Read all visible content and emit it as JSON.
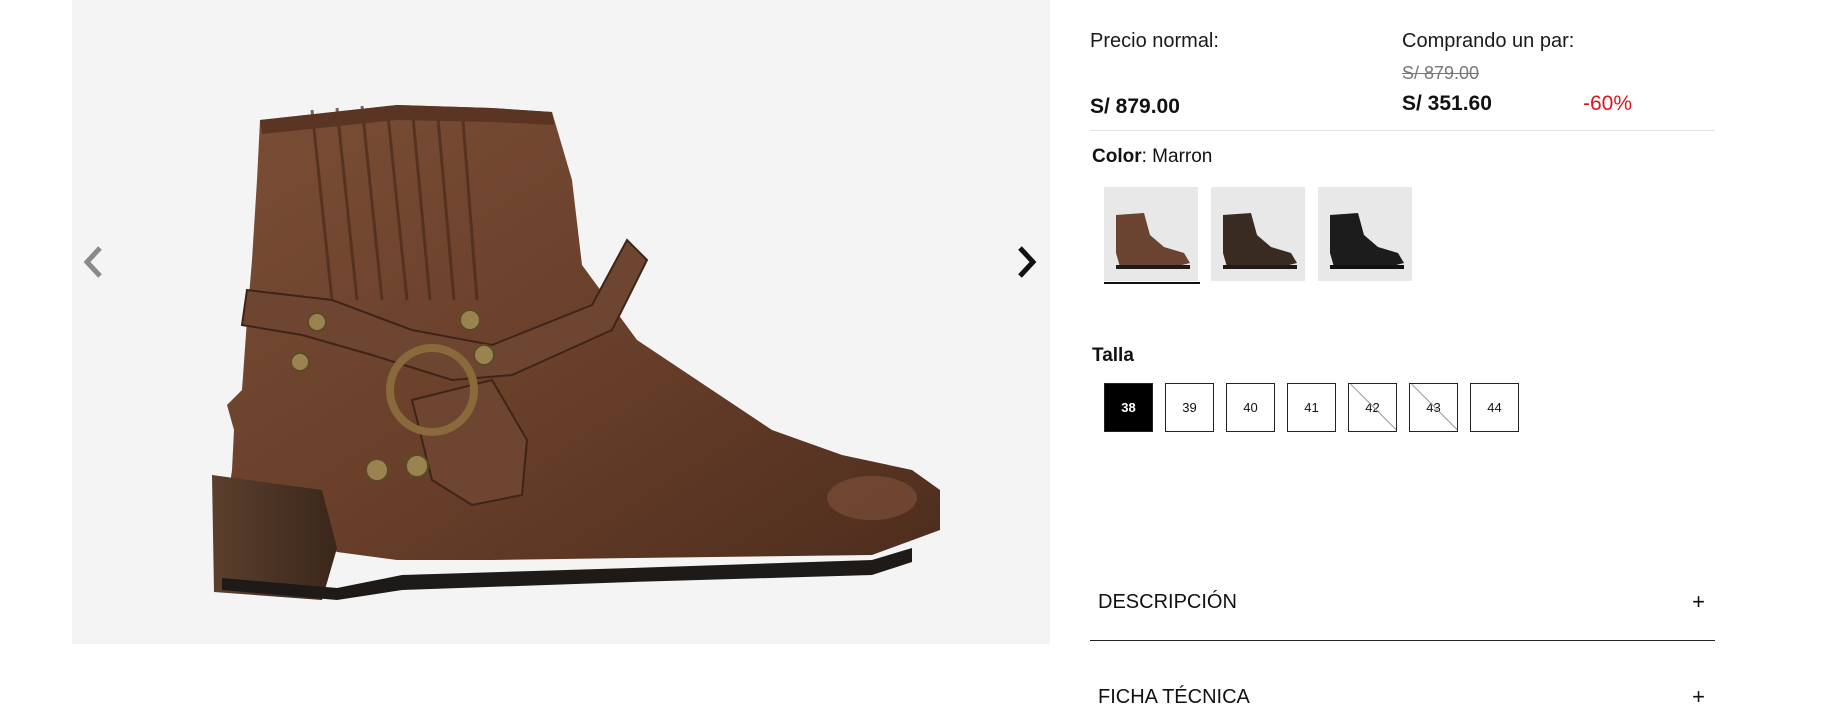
{
  "gallery": {
    "image_alt": "Botin marron con correa y hebilla",
    "prev_icon": "chevron-left-icon",
    "next_icon": "chevron-right-icon"
  },
  "pricing": {
    "normal_label": "Precio normal:",
    "normal_price": "S/ 879.00",
    "pair_label": "Comprando un par:",
    "pair_old_price": "S/ 879.00",
    "pair_price": "S/ 351.60",
    "discount": "-60%",
    "discount_color": "#e0141e"
  },
  "color": {
    "label": "Color",
    "value": "Marron",
    "swatches": [
      {
        "name": "Marron",
        "selected": true,
        "tone": "#6b4431"
      },
      {
        "name": "Cafe oscuro",
        "selected": false,
        "tone": "#3a2b22"
      },
      {
        "name": "Negro",
        "selected": false,
        "tone": "#1c1c1c"
      }
    ]
  },
  "size": {
    "label": "Talla",
    "options": [
      {
        "value": "38",
        "state": "selected"
      },
      {
        "value": "39",
        "state": "available"
      },
      {
        "value": "40",
        "state": "available"
      },
      {
        "value": "41",
        "state": "available"
      },
      {
        "value": "42",
        "state": "unavailable"
      },
      {
        "value": "43",
        "state": "unavailable"
      },
      {
        "value": "44",
        "state": "available"
      }
    ]
  },
  "accordion": {
    "description_label": "DESCRIPCIÓN",
    "tech_label": "FICHA TÉCNICA",
    "expand_symbol": "+"
  }
}
